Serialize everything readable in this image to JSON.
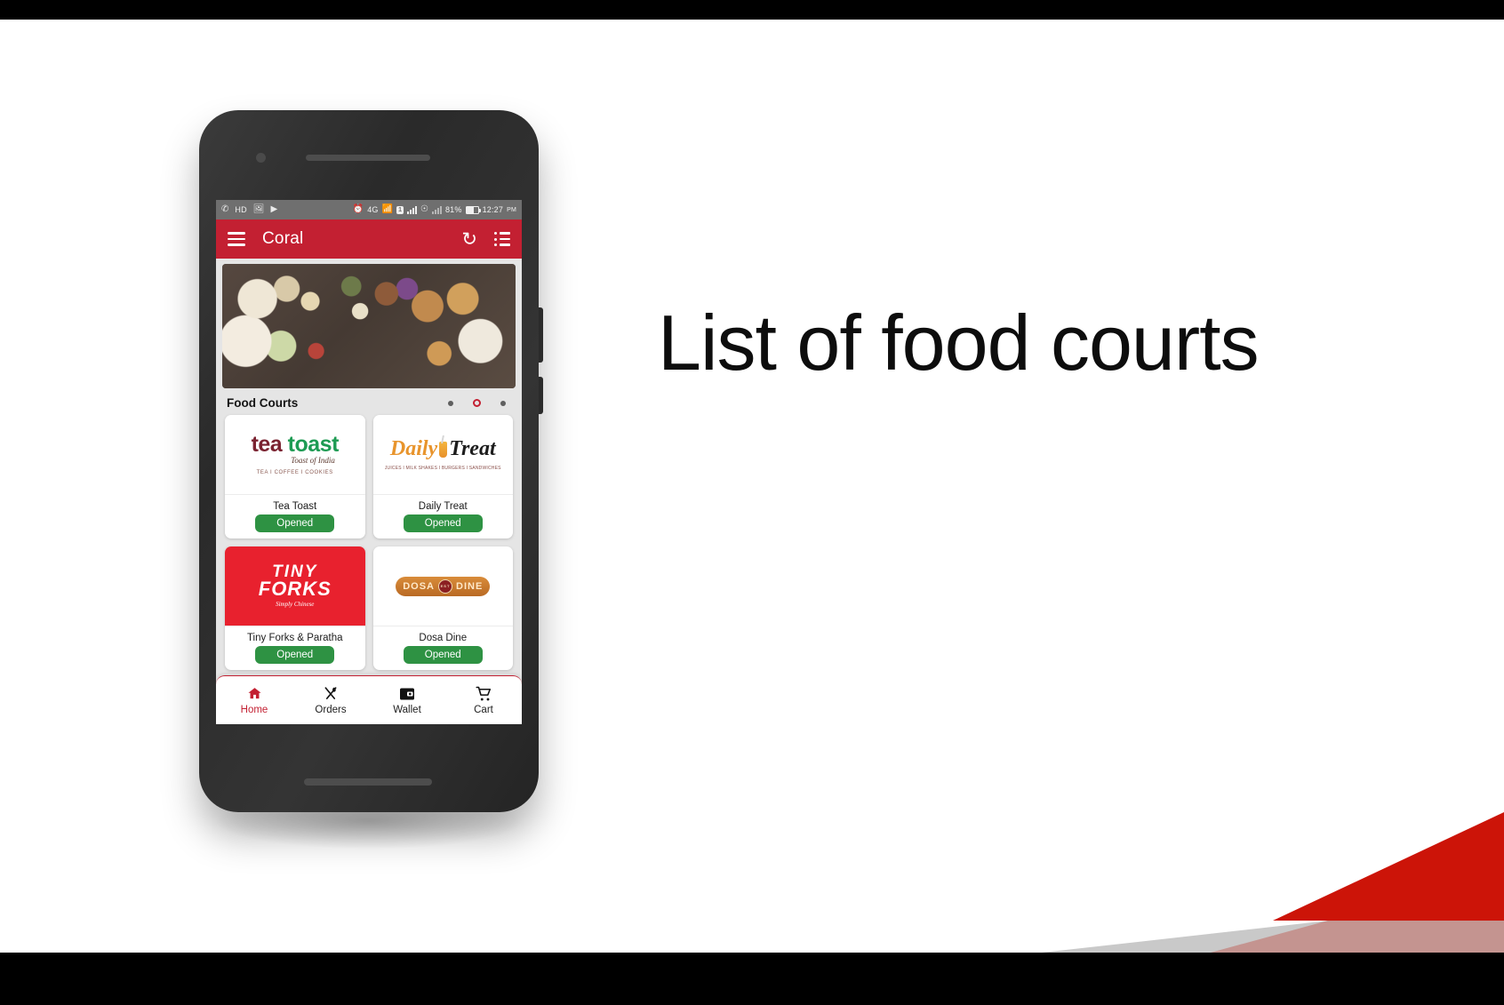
{
  "slide": {
    "heading": "List of food courts",
    "bg_color": "#ffffff",
    "accent_red": "#cc1408",
    "accent_gray": "#c9c9c9",
    "accent_rose": "#c49490"
  },
  "phone": {
    "status_bar": {
      "bg_color": "#6f6f6f",
      "left_icons": [
        "whatsapp-icon",
        "hd-icon",
        "gallery-icon",
        "play-store-icon"
      ],
      "hd_label": "HD",
      "network_label": "4G",
      "volte_label": "VoLTE",
      "sim_badge": "1",
      "battery_percent": "81%",
      "time": "12:27",
      "meridiem": "PM"
    },
    "app_bar": {
      "bg_color": "#c32032",
      "title": "Coral",
      "menu_icon": "hamburger-icon",
      "refresh_icon": "refresh-icon",
      "list_icon": "list-view-icon"
    },
    "hero": {
      "alt": "food-platter-banner"
    },
    "section": {
      "title": "Food Courts",
      "carousel": {
        "dots": 3,
        "active_index": 1
      }
    },
    "food_courts": [
      {
        "name": "Tea Toast",
        "status": "Opened",
        "logo": {
          "kind": "tea-toast-logo",
          "word1": "tea",
          "word2": "toast",
          "tagline": "Toast of India",
          "subline": "TEA  I  COFFEE  I  COOKIES"
        }
      },
      {
        "name": "Daily Treat",
        "status": "Opened",
        "logo": {
          "kind": "daily-treat-logo",
          "word1": "Daily",
          "word2": "Treat",
          "subline": "JUICES I MILK SHAKES I BURGERS I SANDWICHES"
        }
      },
      {
        "name": "Tiny Forks & Paratha",
        "status": "Opened",
        "logo": {
          "kind": "tiny-forks-logo",
          "word1": "TINY",
          "word2": "FORKS",
          "tagline": "Simply Chinese"
        }
      },
      {
        "name": "Dosa Dine",
        "status": "Opened",
        "logo": {
          "kind": "dosa-dine-logo",
          "word1": "DOSA",
          "word2": "DINE",
          "seal": "EST"
        }
      }
    ],
    "bottom_nav": [
      {
        "label": "Home",
        "icon": "home-icon",
        "active": true
      },
      {
        "label": "Orders",
        "icon": "cutlery-icon",
        "active": false
      },
      {
        "label": "Wallet",
        "icon": "wallet-icon",
        "active": false
      },
      {
        "label": "Cart",
        "icon": "cart-icon",
        "active": false
      }
    ]
  }
}
